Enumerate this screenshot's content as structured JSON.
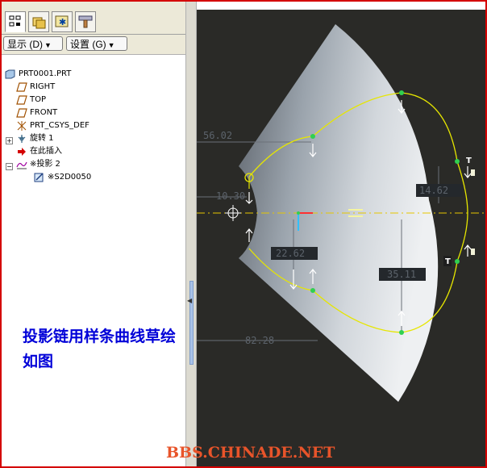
{
  "navigator": {
    "toolbar": {
      "display_button": "显示 (D)",
      "settings_button": "设置 (G)"
    },
    "tree": [
      {
        "label": "PRT0001.PRT",
        "icon": "part-icon"
      },
      {
        "label": "RIGHT",
        "icon": "datum-plane-icon"
      },
      {
        "label": "TOP",
        "icon": "datum-plane-icon"
      },
      {
        "label": "FRONT",
        "icon": "datum-plane-icon"
      },
      {
        "label": "PRT_CSYS_DEF",
        "icon": "coordinate-system-icon"
      },
      {
        "label": "旋转 1",
        "icon": "revolve-icon"
      },
      {
        "label": "在此插入",
        "icon": "insert-here-arrow-icon"
      },
      {
        "label": "※投影 2",
        "icon": "projected-curve-icon"
      },
      {
        "label": "※S2D0050",
        "icon": "sketch-icon"
      }
    ]
  },
  "annotation": {
    "line1": "投影链用样条曲线草绘",
    "line2": "如图"
  },
  "sketch": {
    "dimensions": [
      "56.02",
      "10.30",
      "14.62",
      "22.62",
      "35.11",
      "82.28"
    ],
    "text_symbol": "T"
  },
  "watermark": "BBS.CHINADE.NET",
  "colors": {
    "frame_border": "#d40000",
    "sketch_curve": "#e6e600",
    "centerline": "#e6c600",
    "annotation_text": "#0000d8",
    "watermark": "#e8542a"
  }
}
